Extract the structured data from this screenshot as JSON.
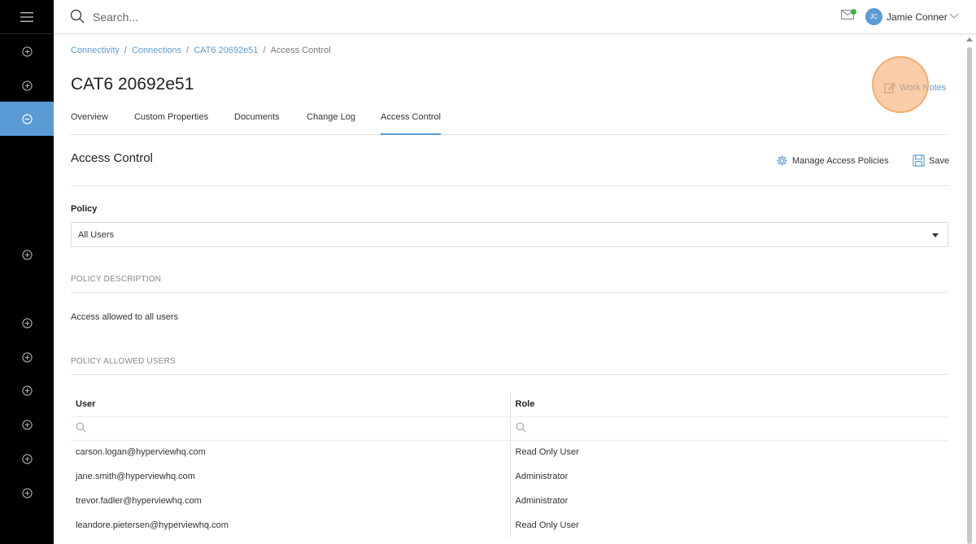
{
  "search": {
    "placeholder": "Search..."
  },
  "user": {
    "initials": "JC",
    "name": "Jamie Conner"
  },
  "breadcrumb": {
    "items": [
      "Connectivity",
      "Connections",
      "CAT6 20692e51"
    ],
    "current": "Access Control"
  },
  "page": {
    "title": "CAT6 20692e51",
    "work_notes": "Work Notes"
  },
  "tabs": [
    "Overview",
    "Custom Properties",
    "Documents",
    "Change Log",
    "Access Control"
  ],
  "section": {
    "title": "Access Control",
    "manage_label": "Manage Access Policies",
    "save_label": "Save"
  },
  "policy": {
    "label": "Policy",
    "selected": "All Users",
    "description_heading": "POLICY DESCRIPTION",
    "description": "Access allowed to all users",
    "allowed_heading": "POLICY ALLOWED USERS"
  },
  "table": {
    "headers": {
      "user": "User",
      "role": "Role"
    },
    "rows": [
      {
        "user": "carson.logan@hyperviewhq.com",
        "role": "Read Only User"
      },
      {
        "user": "jane.smith@hyperviewhq.com",
        "role": "Administrator"
      },
      {
        "user": "trevor.fadler@hyperviewhq.com",
        "role": "Administrator"
      },
      {
        "user": "leandore.pietersen@hyperviewhq.com",
        "role": "Read Only User"
      }
    ]
  },
  "colors": {
    "accent": "#5b9bd5",
    "sidebar": "#000000",
    "notification": "#3cb34a",
    "highlight": "#f4a460"
  },
  "icons": [
    "menu-icon",
    "search-icon",
    "mail-icon",
    "chevron-down-icon",
    "edit-icon",
    "gear-icon",
    "save-icon",
    "plus-circle-icon",
    "minus-circle-icon"
  ]
}
